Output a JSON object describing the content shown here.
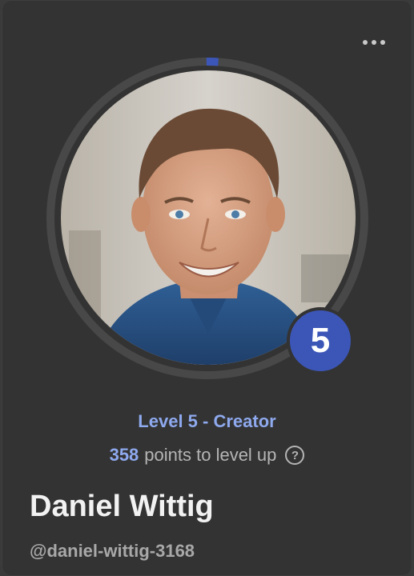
{
  "profile": {
    "name": "Daniel Wittig",
    "handle": "@daniel-wittig-3168",
    "level_number": "5",
    "level_title": "Level 5 - Creator",
    "points_to_level_up": "358",
    "points_suffix": "points to level up",
    "level_progress": 0.01
  },
  "icons": {
    "more": "more-horizontal-icon",
    "help": "question-circle-icon"
  },
  "help_glyph": "?",
  "colors": {
    "card_bg": "#333333",
    "accent": "#3c56b8",
    "accent_text": "#8ea9ee",
    "ring_track": "#4a4a4a"
  }
}
